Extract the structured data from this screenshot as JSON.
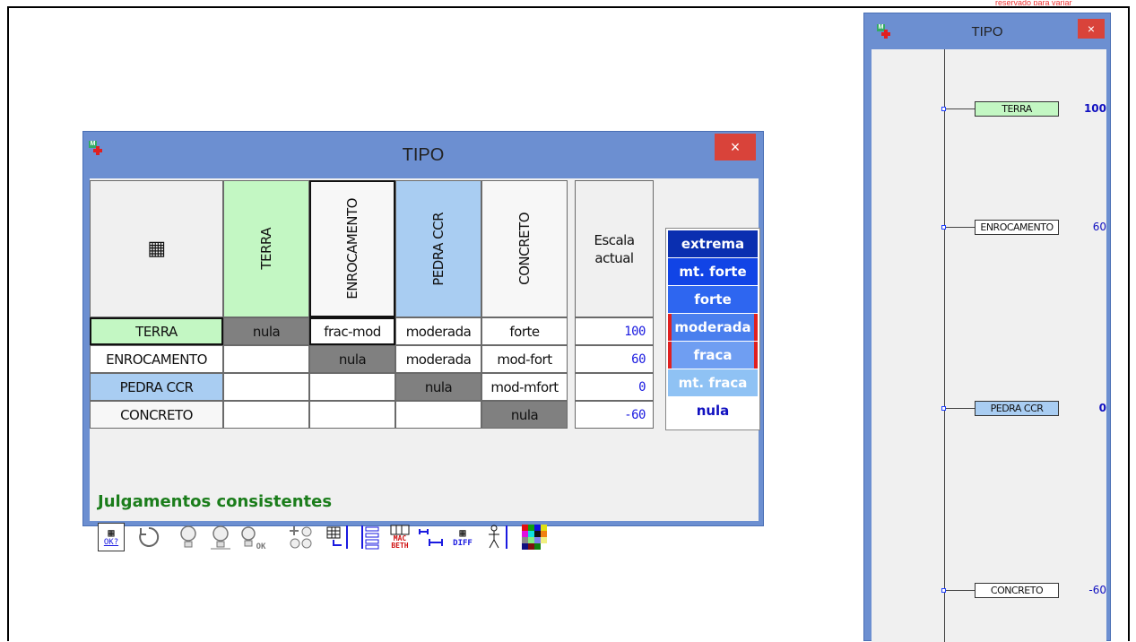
{
  "note_top": "reservado para variar",
  "main_window": {
    "title": "TIPO",
    "close_label": "×",
    "corner_icon": "calculator-icon",
    "corner_glyph": "▦",
    "columns": [
      "TERRA",
      "ENROCAMENTO",
      "PEDRA CCR",
      "CONCRETO"
    ],
    "scale_header": "Escala actual",
    "rows": [
      {
        "label": "TERRA",
        "cells": [
          "nula",
          "frac-mod",
          "moderada",
          "forte"
        ],
        "scale": "100"
      },
      {
        "label": "ENROCAMENTO",
        "cells": [
          "",
          "nula",
          "moderada",
          "mod-fort"
        ],
        "scale": "60"
      },
      {
        "label": "PEDRA CCR",
        "cells": [
          "",
          "",
          "nula",
          "mod-mfort"
        ],
        "scale": "0"
      },
      {
        "label": "CONCRETO",
        "cells": [
          "",
          "",
          "",
          "nula"
        ],
        "scale": "-60"
      }
    ],
    "scale_legend": [
      "extrema",
      "mt. forte",
      "forte",
      "moderada",
      "fraca",
      "mt. fraca",
      "nula"
    ],
    "status": "Julgamentos consistentes",
    "toolbar": [
      {
        "icon": "matrix-ok-icon",
        "label": "OK?"
      },
      {
        "icon": "refresh-icon",
        "label": ""
      },
      {
        "icon": "bulb-icon",
        "label": ""
      },
      {
        "icon": "bulb-sync-icon",
        "label": ""
      },
      {
        "icon": "bulb-ok-icon",
        "label": "OK"
      },
      {
        "icon": "add-bulbs-icon",
        "label": ""
      },
      {
        "icon": "matrix-export-icon",
        "label": ""
      },
      {
        "icon": "list-scale-icon",
        "label": ""
      },
      {
        "icon": "macbeth-icon",
        "label": "MAC BETH"
      },
      {
        "icon": "interval-icon",
        "label": ""
      },
      {
        "icon": "diff-icon",
        "label": "DIFF"
      },
      {
        "icon": "person-scale-icon",
        "label": ""
      },
      {
        "icon": "color-palette-icon",
        "label": ""
      }
    ]
  },
  "scale_window": {
    "title": "TIPO",
    "close_label": "×",
    "items": [
      {
        "label": "TERRA",
        "value": "100",
        "value_color": "#1010c0",
        "bold": true
      },
      {
        "label": "ENROCAMENTO",
        "value": "60",
        "value_color": "#1010c0",
        "bold": false
      },
      {
        "label": "PEDRA CCR",
        "value": "0",
        "value_color": "#1010c0",
        "bold": true
      },
      {
        "label": "CONCRETO",
        "value": "-60",
        "value_color": "#1010c0",
        "bold": false
      }
    ]
  }
}
